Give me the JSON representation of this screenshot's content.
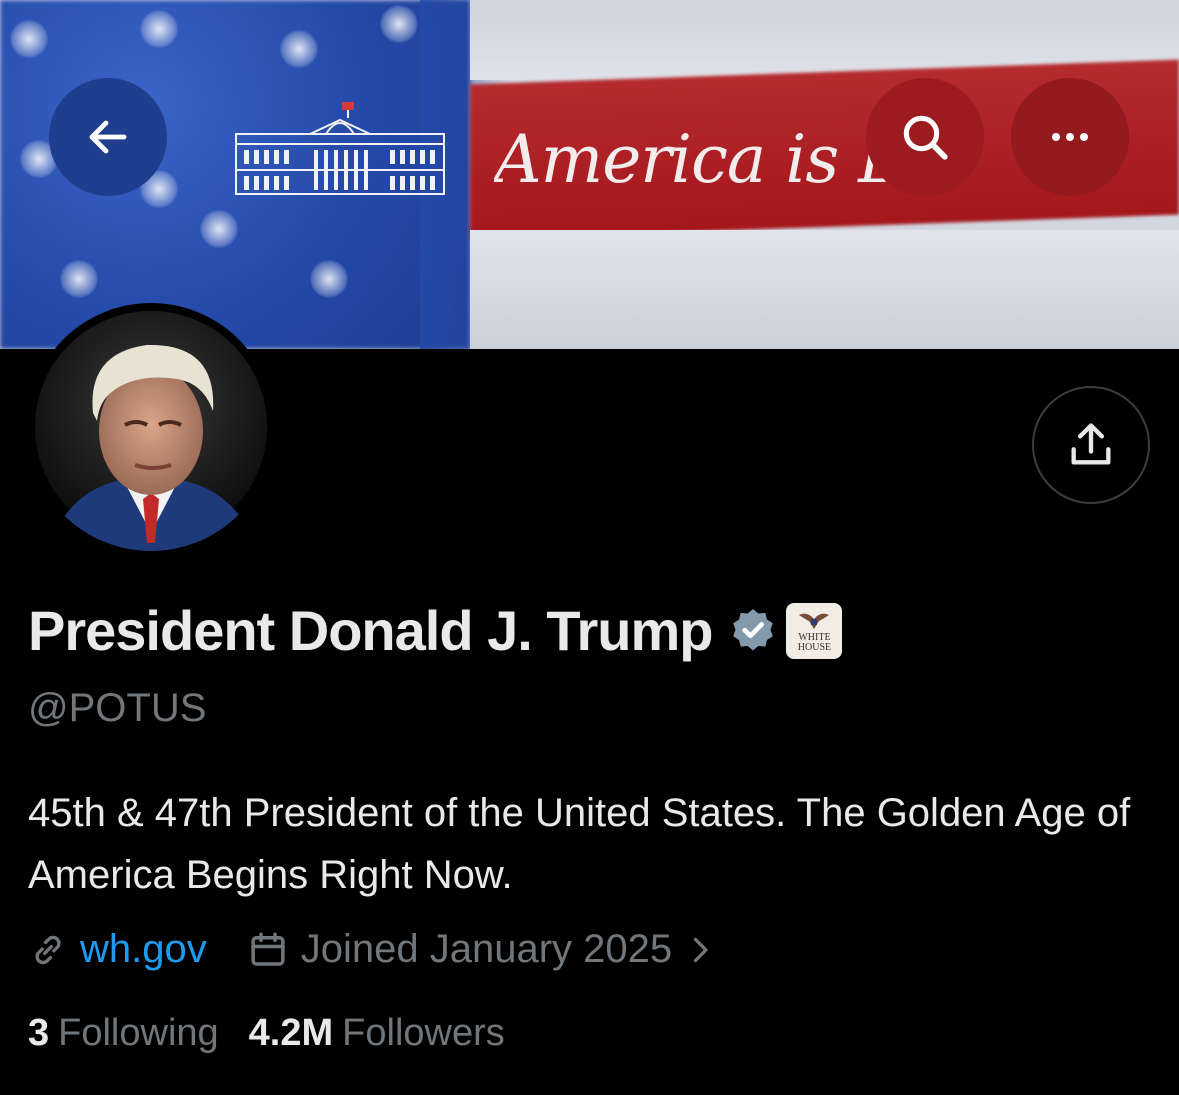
{
  "banner": {
    "text": "America is BAC",
    "colors": {
      "blue": "#2449a8",
      "red": "#a4171c",
      "white": "#dfe2e8"
    }
  },
  "nav": {
    "back_icon": "arrow-left-icon",
    "search_icon": "search-icon",
    "more_icon": "more-horizontal-icon",
    "share_icon": "share-upload-icon"
  },
  "profile": {
    "name": "President Donald J. Trump",
    "handle": "@POTUS",
    "verified_color": "#829aab",
    "affiliation_badge": {
      "line1": "WHITE",
      "line2": "HOUSE"
    },
    "bio": "45th & 47th President of the United States. The Golden Age of America Begins Right Now.",
    "website": "wh.gov",
    "joined": "Joined January 2025"
  },
  "stats": {
    "following_count": "3",
    "following_label": "Following",
    "followers_count": "4.2M",
    "followers_label": "Followers"
  },
  "colors": {
    "background": "#000000",
    "text": "#e7e9ea",
    "muted": "#71767b",
    "link": "#1d9bf0"
  }
}
